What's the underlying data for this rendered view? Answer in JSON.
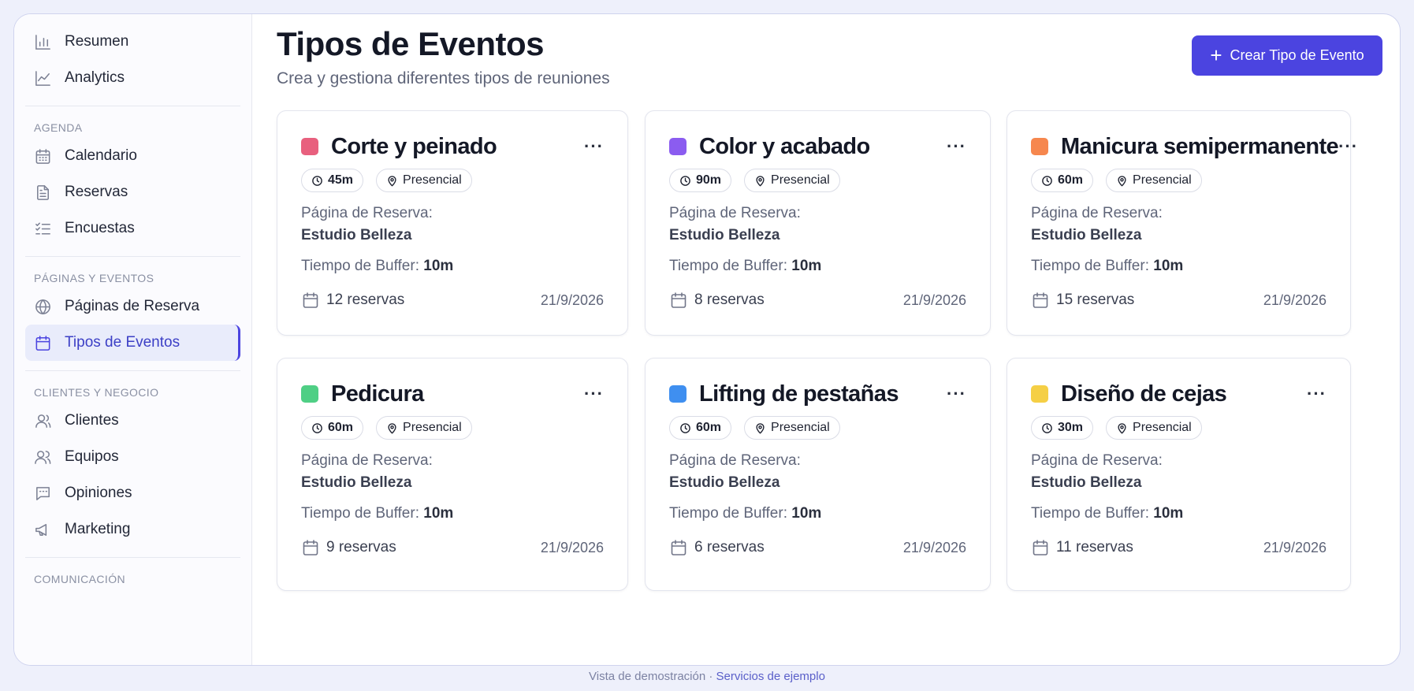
{
  "sidebar": {
    "top_items": [
      {
        "label": "Resumen",
        "icon": "bar-chart-icon"
      },
      {
        "label": "Analytics",
        "icon": "line-chart-icon"
      }
    ],
    "sections": [
      {
        "label": "AGENDA",
        "items": [
          {
            "label": "Calendario",
            "icon": "calendar-icon"
          },
          {
            "label": "Reservas",
            "icon": "document-icon"
          },
          {
            "label": "Encuestas",
            "icon": "checklist-icon"
          }
        ]
      },
      {
        "label": "PÁGINAS Y EVENTOS",
        "items": [
          {
            "label": "Páginas de Reserva",
            "icon": "globe-icon"
          },
          {
            "label": "Tipos de Eventos",
            "icon": "calendar-icon",
            "active": true
          }
        ]
      },
      {
        "label": "CLIENTES Y NEGOCIO",
        "items": [
          {
            "label": "Clientes",
            "icon": "user-icon"
          },
          {
            "label": "Equipos",
            "icon": "users-icon"
          },
          {
            "label": "Opiniones",
            "icon": "message-icon"
          },
          {
            "label": "Marketing",
            "icon": "megaphone-icon"
          }
        ]
      },
      {
        "label": "COMUNICACIÓN",
        "items": []
      }
    ]
  },
  "header": {
    "title": "Tipos de Eventos",
    "subtitle": "Crea y gestiona diferentes tipos de reuniones",
    "create_button": "Crear Tipo de Evento"
  },
  "common": {
    "booking_page_label": "Página de Reserva:",
    "buffer_label": "Tiempo de Buffer:"
  },
  "cards": [
    {
      "title": "Corte y peinado",
      "color": "#e8607e",
      "duration": "45m",
      "location": "Presencial",
      "booking_page": "Estudio Belleza",
      "buffer": "10m",
      "bookings": "12 reservas",
      "date": "21/9/2026"
    },
    {
      "title": "Color y acabado",
      "color": "#8b5cf0",
      "duration": "90m",
      "location": "Presencial",
      "booking_page": "Estudio Belleza",
      "buffer": "10m",
      "bookings": "8 reservas",
      "date": "21/9/2026"
    },
    {
      "title": "Manicura semipermanente",
      "color": "#f6874e",
      "duration": "60m",
      "location": "Presencial",
      "booking_page": "Estudio Belleza",
      "buffer": "10m",
      "bookings": "15 reservas",
      "date": "21/9/2026"
    },
    {
      "title": "Pedicura",
      "color": "#4fcf85",
      "duration": "60m",
      "location": "Presencial",
      "booking_page": "Estudio Belleza",
      "buffer": "10m",
      "bookings": "9 reservas",
      "date": "21/9/2026"
    },
    {
      "title": "Lifting de pestañas",
      "color": "#3f8ff0",
      "duration": "60m",
      "location": "Presencial",
      "booking_page": "Estudio Belleza",
      "buffer": "10m",
      "bookings": "6 reservas",
      "date": "21/9/2026"
    },
    {
      "title": "Diseño de cejas",
      "color": "#f5cf45",
      "duration": "30m",
      "location": "Presencial",
      "booking_page": "Estudio Belleza",
      "buffer": "10m",
      "bookings": "11 reservas",
      "date": "21/9/2026"
    }
  ],
  "footer": {
    "text": "Vista de demostración · ",
    "link": "Servicios de ejemplo"
  }
}
